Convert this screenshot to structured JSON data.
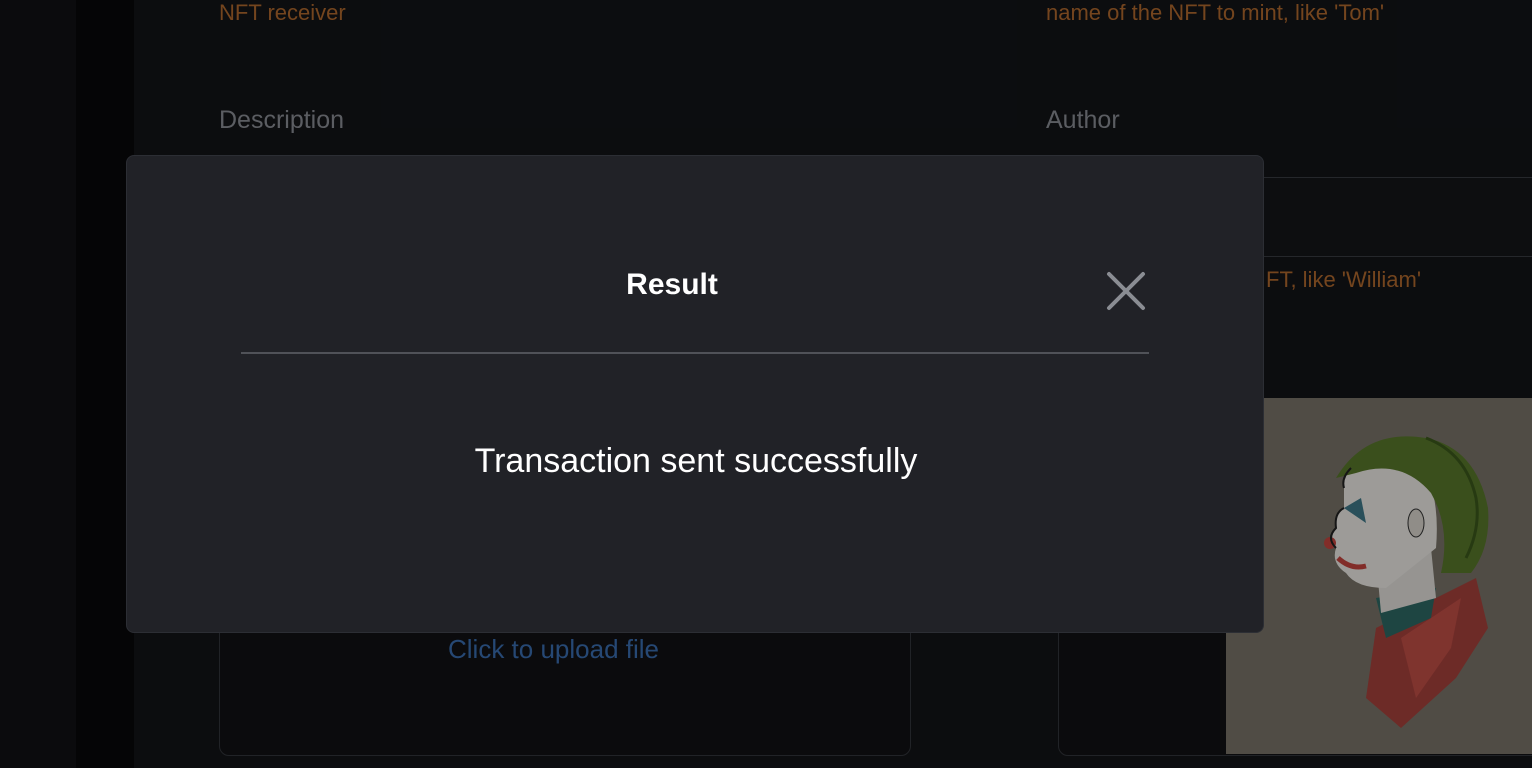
{
  "form": {
    "receiver_hint": "NFT receiver",
    "name_hint": "name of the NFT to mint, like 'Tom'",
    "description_label": "Description",
    "author_label": "Author",
    "author_hint": "FT, like 'William'",
    "upload_text": "Click to upload file"
  },
  "modal": {
    "title": "Result",
    "message": "Transaction sent successfully",
    "close_icon": "close-icon"
  },
  "colors": {
    "hint": "#b36a2e",
    "link": "#3b6fb3",
    "modal_bg": "#212227"
  }
}
